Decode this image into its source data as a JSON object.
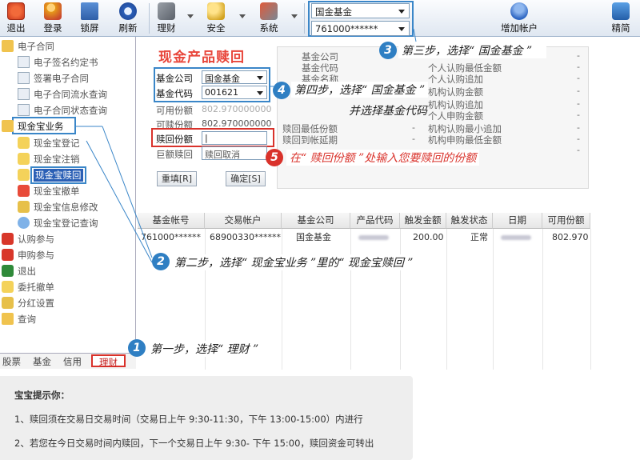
{
  "toolbar": {
    "exit": "退出",
    "login": "登录",
    "lock": "锁屏",
    "refresh": "刷新",
    "finance": "理财",
    "security": "安全",
    "system": "系统",
    "fund_combo": "国金基金",
    "account_combo": "761000******",
    "add_account": "增加帐户",
    "compact": "精简"
  },
  "sidebar": {
    "contract": "电子合同",
    "contract_items": [
      "电子签名约定书",
      "签署电子合同",
      "电子合同流水查询",
      "电子合同状态查询"
    ],
    "cash": "现金宝业务",
    "cash_items": [
      "现金宝登记",
      "现金宝注销",
      "现金宝赎回",
      "现金宝撤单",
      "现金宝信息修改",
      "现金宝登记查询"
    ],
    "other_items": [
      "认购参与",
      "申购参与",
      "退出",
      "委托撤单",
      "分红设置",
      "查询"
    ]
  },
  "tabs": [
    "股票",
    "基金",
    "信用",
    "理财"
  ],
  "form": {
    "title": "现金产品赎回",
    "company_label": "基金公司",
    "company_value": "国金基金",
    "code_label": "基金代码",
    "code_value": "001621",
    "available_label": "可用份额",
    "available_value": "802.970000000",
    "redeemable_label": "可赎份额",
    "redeemable_value": "802.970000000",
    "redeem_label": "赎回份额",
    "redeem_value": "|",
    "giant_label": "巨额赎回",
    "giant_value": "赎回取消",
    "reset_btn": "重填[R]",
    "confirm_btn": "确定[S]"
  },
  "info": {
    "left_labels": [
      "基金公司",
      "基金代码",
      "基金名称",
      "赎回最低份额",
      "赎回到帐延期"
    ],
    "left_values": [
      "-",
      "-"
    ],
    "right_labels": [
      "个人认购最低金额",
      "个人认购追加",
      "机构认购金额",
      "机构认购追加",
      "个人申购金额",
      "机构认购最小追加",
      "机构申购最低金额"
    ],
    "right_values": [
      "-",
      "-",
      "-",
      "-",
      "-",
      "-",
      "-",
      "-",
      "-"
    ]
  },
  "grid": {
    "headers": [
      "基金帐号",
      "交易帐户",
      "基金公司",
      "产品代码",
      "触发金额",
      "触发状态",
      "日期",
      "可用份额"
    ],
    "row": [
      "761000******",
      "68900330******",
      "国金基金",
      "",
      "200.00",
      "正常",
      "",
      "802.970"
    ]
  },
  "steps": {
    "s1": "第一步，选择“ 理财 ”",
    "s2": "第二步，选择“ 现金宝业务 ”里的“ 现金宝赎回 ”",
    "s3": "第三步，选择“ 国金基金 ”",
    "s4a": "第四步，选择“ 国金基金 ”",
    "s4b": "并选择基金代码",
    "s5": "在“ 赎回份额 ”处输入您要赎回的份额",
    "n1": "1",
    "n2": "2",
    "n3": "3",
    "n4": "4",
    "n5": "5"
  },
  "tips": {
    "title": "宝宝提示你：",
    "line1": "1、赎回须在交易日交易时间（交易日上午 9:30-11:30，下午 13:00-15:00）内进行",
    "line2": "2、若您在今日交易时间内赎回，下一个交易日上午 9:30- 下午 15:00，赎回资金可转出"
  },
  "colors": {
    "accent_red": "#e8463b",
    "step_blue": "#2f7fc3",
    "step_red": "#d9322b"
  }
}
